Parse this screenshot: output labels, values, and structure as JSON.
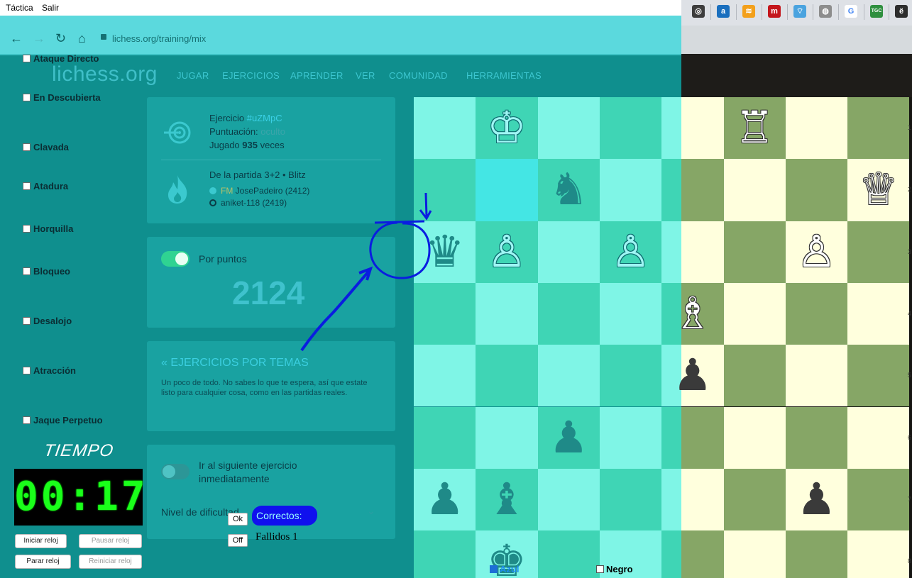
{
  "menubar": {
    "items": [
      "Táctica",
      "Salir"
    ]
  },
  "browser": {
    "url": "lichess.org/training/mix",
    "bookmarks": [
      {
        "name": "openai-bookmark",
        "glyph": "◎",
        "color": "#3d3d3d"
      },
      {
        "name": "a-bookmark",
        "glyph": "a",
        "color": "#1a6fbe"
      },
      {
        "name": "stack-bookmark",
        "glyph": "≋",
        "color": "#f3a01b"
      },
      {
        "name": "red-bookmark",
        "glyph": "m",
        "color": "#c4161c"
      },
      {
        "name": "wifi-bookmark",
        "glyph": "⌔",
        "color": "#4aa3df"
      },
      {
        "name": "globe-bookmark",
        "glyph": "◍",
        "color": "#8d8d8d"
      },
      {
        "name": "google-bookmark",
        "glyph": "G",
        "color": "#ffffff"
      },
      {
        "name": "tgc-bookmark",
        "glyph": "TGC",
        "color": "#2f8f3f"
      },
      {
        "name": "e-bookmark",
        "glyph": "ë",
        "color": "#2d2d2d"
      }
    ]
  },
  "lichess": {
    "logo": "lichess.org",
    "nav": [
      "JUGAR",
      "EJERCICIOS",
      "APRENDER",
      "VER",
      "COMUNIDAD",
      "HERRAMIENTAS"
    ]
  },
  "topics": [
    "Ataque Directo",
    "En Descubierta",
    "Clavada",
    "Atadura",
    "Horquilla",
    "Bloqueo",
    "Desalojo",
    "Atracción",
    "Jaque Perpetuo"
  ],
  "timer": {
    "label": "TIEMPO",
    "display": "00:17",
    "buttons": {
      "start": "Iniciar reloj",
      "pause": "Pausar reloj",
      "stop": "Parar reloj",
      "reset": "Reiniciar reloj"
    }
  },
  "puzzle": {
    "ejercicio_label": "Ejercicio",
    "ejercicio_id": "#uZMpC",
    "puntuacion_label": "Puntuación:",
    "puntuacion_value": "oculto",
    "jugado_pre": "Jugado",
    "jugado_count": "935",
    "jugado_post": "veces",
    "game_info": "De la partida 3+2 • Blitz",
    "player_white_title": "FM",
    "player_white": "JosePadeiro (2412)",
    "player_black": "aniket-118 (2419)"
  },
  "rating": {
    "label": "Por puntos",
    "value": "2124"
  },
  "theme": {
    "title": "« EJERCICIOS POR TEMAS",
    "desc": "Un poco de todo. No sabes lo que te espera, así que estate listo para cualquier cosa, como en las partidas reales."
  },
  "next": {
    "label": "Ir al siguiente ejercicio inmediatamente",
    "difficulty_label": "Nivel de dificultad"
  },
  "results": {
    "ok_btn": "Ok",
    "off_btn": "Off",
    "correctos": "Correctos:",
    "fallidos": "Fallidos 1"
  },
  "board": {
    "pieces": [
      {
        "file": 1,
        "rank": 0,
        "glyph": "♔",
        "color": "white",
        "name": "white-king"
      },
      {
        "file": 5,
        "rank": 0,
        "glyph": "♖",
        "color": "white",
        "name": "white-rook"
      },
      {
        "file": 2,
        "rank": 1,
        "glyph": "♞",
        "color": "black",
        "name": "black-knight"
      },
      {
        "file": 7,
        "rank": 1,
        "glyph": "♕",
        "color": "white",
        "name": "white-queen"
      },
      {
        "file": 0,
        "rank": 2,
        "glyph": "♛",
        "color": "black",
        "name": "black-queen"
      },
      {
        "file": 1,
        "rank": 2,
        "glyph": "♙",
        "color": "white",
        "name": "white-pawn"
      },
      {
        "file": 3,
        "rank": 2,
        "glyph": "♙",
        "color": "white",
        "name": "white-pawn"
      },
      {
        "file": 6,
        "rank": 2,
        "glyph": "♙",
        "color": "white",
        "name": "white-pawn"
      },
      {
        "file": 4,
        "rank": 3,
        "glyph": "♗",
        "color": "white",
        "name": "white-bishop"
      },
      {
        "file": 4,
        "rank": 4,
        "glyph": "♟",
        "color": "black",
        "name": "black-pawn"
      },
      {
        "file": 2,
        "rank": 5,
        "glyph": "♟",
        "color": "black",
        "name": "black-pawn"
      },
      {
        "file": 0,
        "rank": 6,
        "glyph": "♟",
        "color": "black",
        "name": "black-pawn"
      },
      {
        "file": 1,
        "rank": 6,
        "glyph": "♝",
        "color": "black",
        "name": "black-bishop"
      },
      {
        "file": 6,
        "rank": 6,
        "glyph": "♟",
        "color": "black",
        "name": "black-pawn"
      },
      {
        "file": 1,
        "rank": 7,
        "glyph": "♚",
        "color": "black",
        "name": "black-king"
      }
    ],
    "highlight": {
      "file": 1,
      "rank": 1
    },
    "colors": {
      "light": "#ffffdd",
      "dark": "#86a666",
      "tint_light": "#7ff5e6",
      "tint_dark": "#3fd5b5",
      "highlight": "#44e6e4"
    },
    "coords": [
      "1",
      "2",
      "3",
      "4",
      "5",
      "6",
      "7",
      "8"
    ]
  },
  "color_choice": {
    "blue": "Azul",
    "black": "Negro"
  }
}
